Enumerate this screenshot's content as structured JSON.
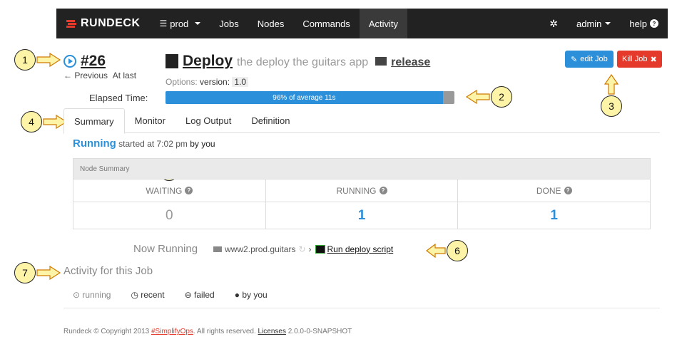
{
  "navbar": {
    "brand": "RUNDECK",
    "project": "prod",
    "items": [
      "Jobs",
      "Nodes",
      "Commands",
      "Activity"
    ],
    "user": "admin",
    "help": "help"
  },
  "execution": {
    "id": "#26",
    "previous": "Previous",
    "at_last": "At last",
    "job_name": "Deploy",
    "job_description": "the deploy the guitars app",
    "group": "release",
    "options_label": "Options:",
    "option_key": "version:",
    "option_value": "1.0",
    "elapsed_label": "Elapsed Time:",
    "progress_text": "96% of average 11s",
    "progress_percent": 96,
    "edit_button": "edit Job",
    "kill_button": "Kill Job"
  },
  "tabs": [
    "Summary",
    "Monitor",
    "Log Output",
    "Definition"
  ],
  "status": {
    "state": "Running",
    "started": "started at 7:02 pm",
    "by": "by you"
  },
  "node_summary": {
    "title": "Node Summary",
    "columns": [
      {
        "label": "WAITING",
        "value": "0",
        "color": "#999999"
      },
      {
        "label": "RUNNING",
        "value": "1",
        "color": "#2b90d9"
      },
      {
        "label": "DONE",
        "value": "1",
        "color": "#2b90d9"
      }
    ]
  },
  "now_running": {
    "label": "Now Running",
    "node": "www2.prod.guitars",
    "step": "Run deploy script"
  },
  "activity": {
    "title": "Activity for this Job",
    "filters": [
      "running",
      "recent",
      "failed",
      "by you"
    ]
  },
  "footer": {
    "prefix": "Rundeck © Copyright 2013",
    "brand_link": "#SimplifyOps",
    "rights": ". All rights reserved.",
    "licenses": "Licenses",
    "version": "2.0.0-0-SNAPSHOT"
  },
  "callouts": [
    "1",
    "2",
    "3",
    "4",
    "5",
    "6",
    "7"
  ],
  "colors": {
    "accent": "#2b90d9",
    "danger": "#e5392b",
    "callout": "#fdf4a8"
  }
}
